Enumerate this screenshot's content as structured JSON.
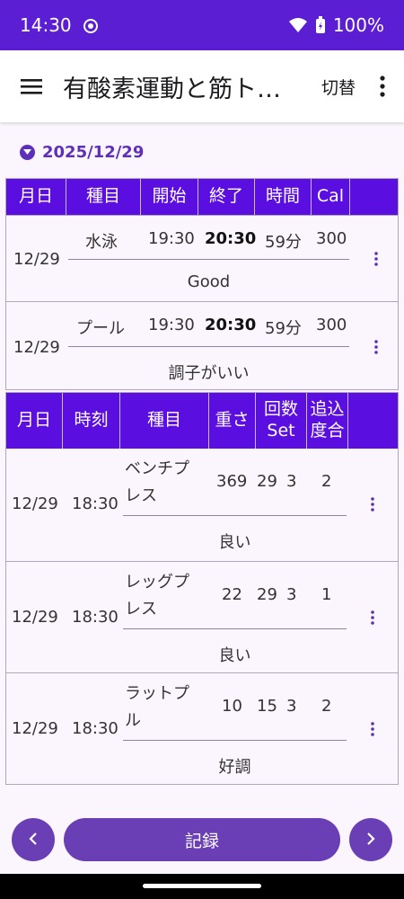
{
  "status": {
    "time": "14:30",
    "battery": "100%"
  },
  "appbar": {
    "title": "有酸素運動と筋ト…",
    "switch_label": "切替"
  },
  "date": "2025/12/29",
  "cardio": {
    "headers": [
      "月日",
      "種目",
      "開始",
      "終了",
      "時間",
      "Cal"
    ],
    "rows": [
      {
        "date": "12/29",
        "name": "水泳",
        "start": "19:30",
        "end": "20:30",
        "duration": "59分",
        "cal": "300",
        "note": "Good"
      },
      {
        "date": "12/29",
        "name": "プール",
        "start": "19:30",
        "end": "20:30",
        "duration": "59分",
        "cal": "300",
        "note": "調子がいい"
      }
    ]
  },
  "strength": {
    "headers": [
      "月日",
      "時刻",
      "種目",
      "重さ",
      "回数 Set",
      "追込 度合"
    ],
    "header_lines": [
      [
        "月日"
      ],
      [
        "時刻"
      ],
      [
        "種目"
      ],
      [
        "重さ"
      ],
      [
        "回数",
        "Set"
      ],
      [
        "追込",
        "度合"
      ]
    ],
    "rows": [
      {
        "date": "12/29",
        "time": "18:30",
        "name_lines": [
          "ベンチプ",
          "レス"
        ],
        "weight": "369",
        "reps": "29",
        "sets": "3",
        "level": "2",
        "note": "良い"
      },
      {
        "date": "12/29",
        "time": "18:30",
        "name_lines": [
          "レッグプ",
          "レス"
        ],
        "weight": "22",
        "reps": "29",
        "sets": "3",
        "level": "1",
        "note": "良い"
      },
      {
        "date": "12/29",
        "time": "18:30",
        "name_lines": [
          "ラットプ",
          "ル"
        ],
        "weight": "10",
        "reps": "15",
        "sets": "3",
        "level": "2",
        "note": "好調"
      }
    ]
  },
  "bottom": {
    "record_label": "記録"
  },
  "colors": {
    "primary": "#5b0ee0",
    "accent": "#6a3fb6",
    "status": "#5b1ed3"
  }
}
